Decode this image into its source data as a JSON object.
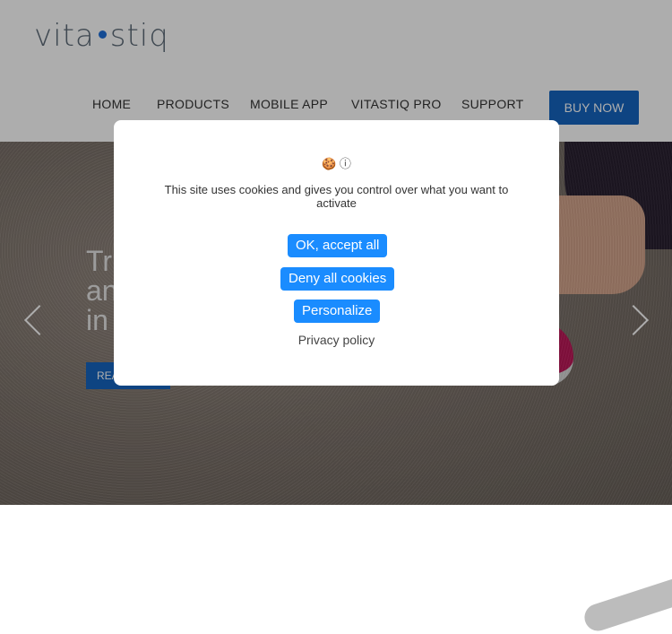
{
  "brand": {
    "logo_left": "vita",
    "logo_right": "stiq"
  },
  "nav": {
    "items": [
      "HOME",
      "PRODUCTS",
      "MOBILE APP",
      "VITASTIQ PRO",
      "SUPPORT"
    ],
    "buy_label": "BUY NOW"
  },
  "hero": {
    "title_lines": [
      "Tr",
      "an",
      "in"
    ],
    "button_label": "REA"
  },
  "cookie_modal": {
    "icon": "cookie-icon",
    "icon_glyph": "🍪 ⓘ",
    "message": "This site uses cookies and gives you control over what you want to activate",
    "accept_label": "OK, accept all",
    "deny_label": "Deny all cookies",
    "personalize_label": "Personalize",
    "policy_label": "Privacy policy",
    "accent_color": "#1a8cff"
  }
}
